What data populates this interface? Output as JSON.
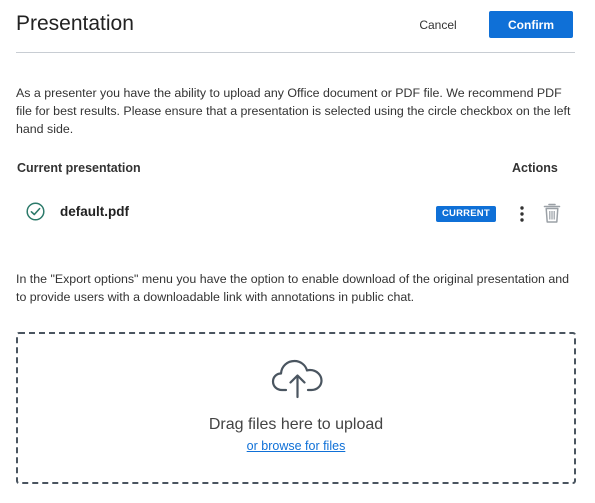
{
  "modal": {
    "title": "Presentation",
    "cancel_label": "Cancel",
    "confirm_label": "Confirm"
  },
  "intro_text": "As a presenter you have the ability to upload any Office document or PDF file. We recommend PDF file for best results. Please ensure that a presentation is selected using the circle checkbox on the left hand side.",
  "table": {
    "header_current": "Current presentation",
    "header_actions": "Actions",
    "rows": [
      {
        "filename": "default.pdf",
        "badge": "CURRENT",
        "selected": true
      }
    ]
  },
  "export_text": "In the \"Export options\" menu you have the option to enable download of the original presentation and to provide users with a downloadable link with annotations in public chat.",
  "dropzone": {
    "main_text": "Drag files here to upload",
    "browse_text": "or browse for files"
  },
  "colors": {
    "accent": "#0f70d7",
    "check": "#2c7a6a"
  },
  "icons": [
    "check-circle-icon",
    "more-vertical-icon",
    "trash-icon",
    "cloud-upload-icon"
  ]
}
